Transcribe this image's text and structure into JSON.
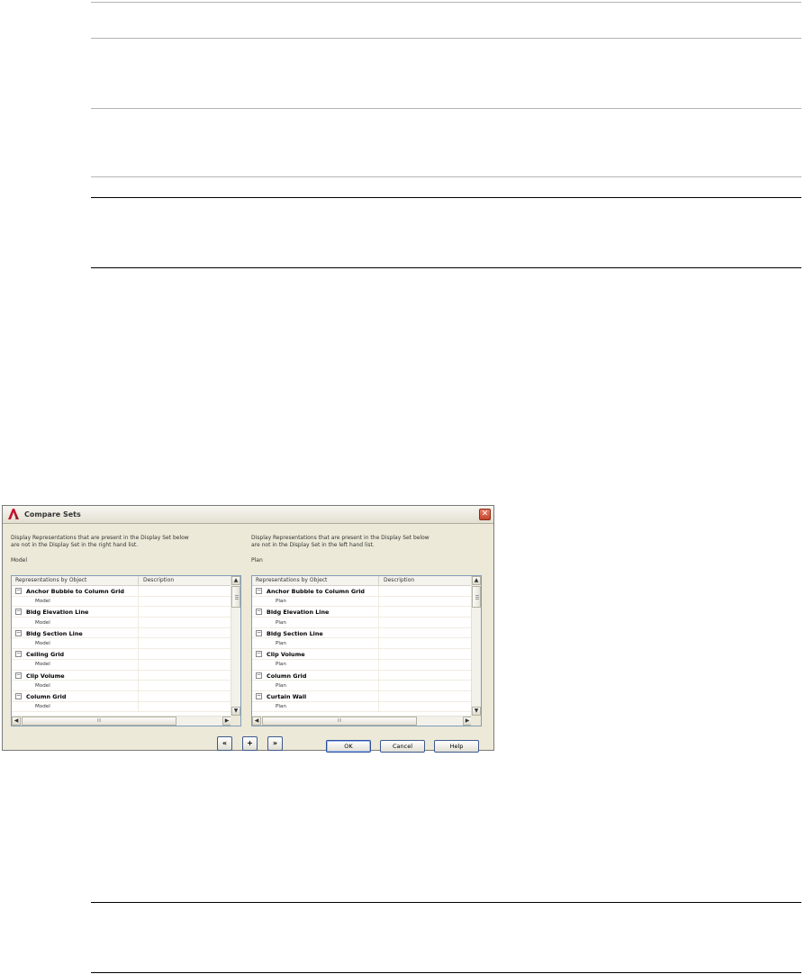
{
  "dialog": {
    "title": "Compare Sets",
    "close_symbol": "✕",
    "left": {
      "description_line1": "Display Representations that are present in the Display Set below",
      "description_line2": "are not in the Display Set in the right hand list.",
      "set_name": "Model",
      "col_headers": [
        "Representations by Object",
        "Description"
      ],
      "rows": [
        {
          "type": "parent",
          "label": "Anchor Bubble to Column Grid"
        },
        {
          "type": "child",
          "label": "Model"
        },
        {
          "type": "parent",
          "label": "Bldg Elevation Line"
        },
        {
          "type": "child",
          "label": "Model"
        },
        {
          "type": "parent",
          "label": "Bldg Section Line"
        },
        {
          "type": "child",
          "label": "Model"
        },
        {
          "type": "parent",
          "label": "Ceiling Grid"
        },
        {
          "type": "child",
          "label": "Model"
        },
        {
          "type": "parent",
          "label": "Clip Volume"
        },
        {
          "type": "child",
          "label": "Model"
        },
        {
          "type": "parent",
          "label": "Column Grid"
        },
        {
          "type": "child",
          "label": "Model"
        }
      ]
    },
    "right": {
      "description_line1": "Display Representations that are present in the Display Set below",
      "description_line2": "are not in the Display Set in the left hand list.",
      "set_name": "Plan",
      "col_headers": [
        "Representations by Object",
        "Description"
      ],
      "rows": [
        {
          "type": "parent",
          "label": "Anchor Bubble to Column Grid"
        },
        {
          "type": "child",
          "label": "Plan"
        },
        {
          "type": "parent",
          "label": "Bldg Elevation Line"
        },
        {
          "type": "child",
          "label": "Plan"
        },
        {
          "type": "parent",
          "label": "Bldg Section Line"
        },
        {
          "type": "child",
          "label": "Plan"
        },
        {
          "type": "parent",
          "label": "Clip Volume"
        },
        {
          "type": "child",
          "label": "Plan"
        },
        {
          "type": "parent",
          "label": "Column Grid"
        },
        {
          "type": "child",
          "label": "Plan"
        },
        {
          "type": "parent",
          "label": "Curtain Wall"
        },
        {
          "type": "child",
          "label": "Plan"
        }
      ]
    },
    "transfer_buttons": {
      "copy_left": "«",
      "add": "+",
      "copy_right": "»"
    },
    "buttons": {
      "ok": "OK",
      "cancel": "Cancel",
      "help": "Help"
    },
    "scroll_glyphs": {
      "up": "▲",
      "down": "▼",
      "left": "◀",
      "right": "▶",
      "thumb_grip": "III"
    },
    "expander_symbol": "−"
  }
}
